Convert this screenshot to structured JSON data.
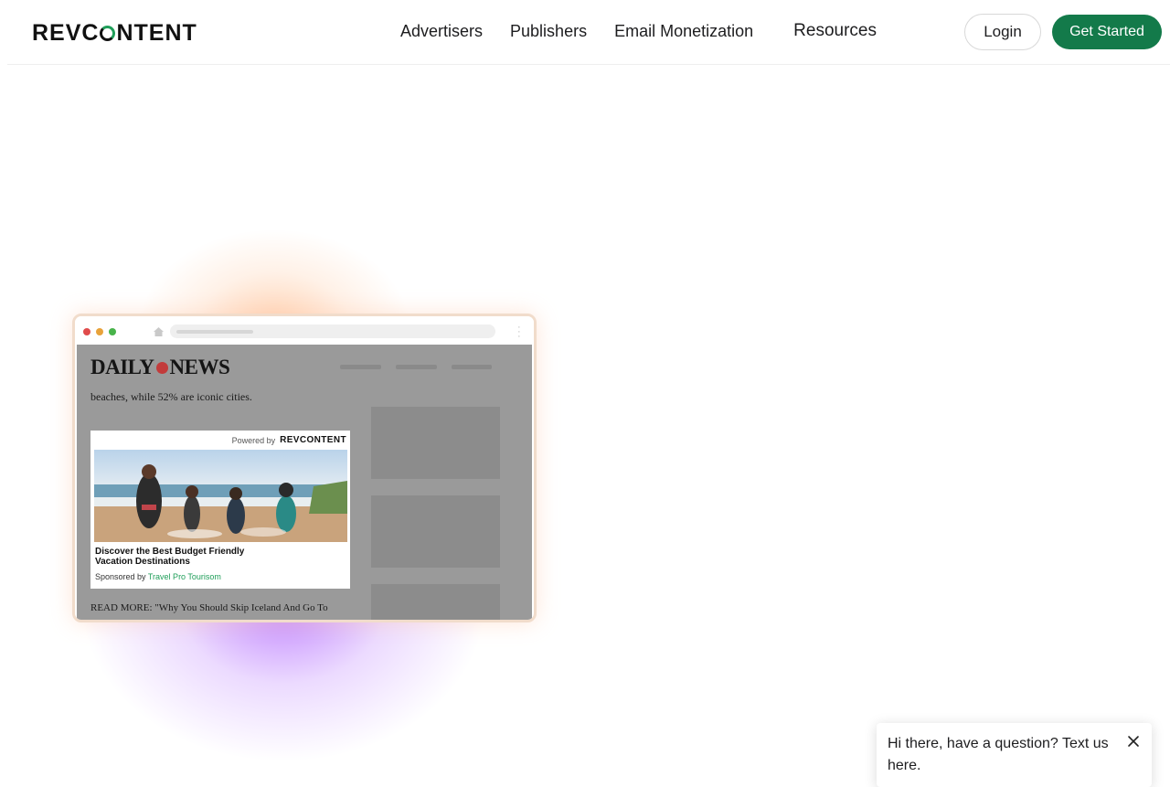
{
  "brand": {
    "logo_left": "REVC",
    "logo_right": "NTENT",
    "accent": "#137a4a"
  },
  "nav": {
    "items": [
      {
        "label": "Advertisers"
      },
      {
        "label": "Publishers"
      },
      {
        "label": "Email Monetization"
      },
      {
        "label": "Resources"
      }
    ]
  },
  "header": {
    "login_label": "Login",
    "cta_label": "Get Started"
  },
  "mockup": {
    "site_logo_left": "DAILY",
    "site_logo_right": "NEWS",
    "snippet": "beaches, while 52% are iconic cities.",
    "ad": {
      "powered_by": "Powered by",
      "powered_brand": "REVCONTENT",
      "title": "Discover the Best Budget Friendly Vacation Destinations",
      "sponsored_prefix": "Sponsored by",
      "sponsor": "Travel Pro Tourisom"
    },
    "read_more": "READ MORE: \"Why You Should Skip Iceland And Go To"
  },
  "chat": {
    "message": "Hi there, have a question? Text us here."
  }
}
